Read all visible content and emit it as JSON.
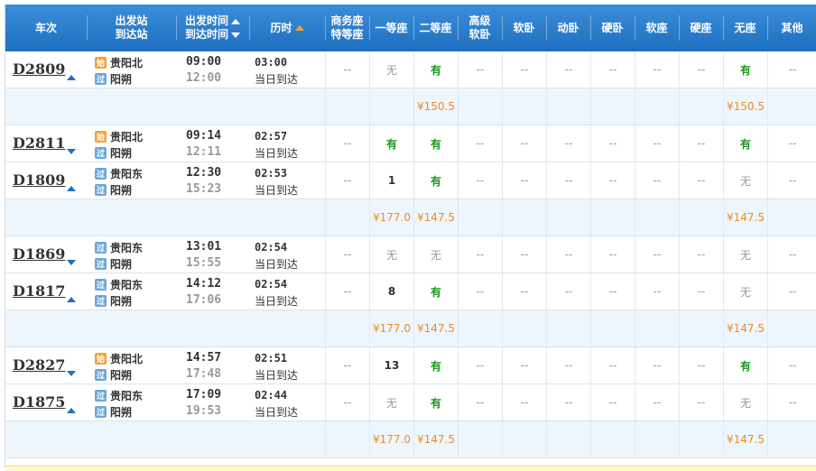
{
  "headers": {
    "train_no": "车次",
    "station_top": "出发站",
    "station_bottom": "到达站",
    "time_top": "出发时间",
    "time_bottom": "到达时间",
    "duration": "历时",
    "business_top": "商务座",
    "business_bottom": "特等座",
    "first": "一等座",
    "second": "二等座",
    "adv_soft_top": "高级",
    "adv_soft_bottom": "软卧",
    "soft_sleeper": "软卧",
    "moving_sleeper": "动卧",
    "hard_sleeper": "硬卧",
    "soft_seat": "软座",
    "hard_seat": "硬座",
    "no_seat": "无座",
    "other": "其他"
  },
  "badges": {
    "start": "始",
    "pass": "过"
  },
  "trains": [
    {
      "no": "D2809",
      "toggle": "up",
      "from": "贵阳北",
      "from_badge": "始",
      "to": "阳朔",
      "to_badge": "过",
      "dep": "09:00",
      "arr": "12:00",
      "dur": "03:00",
      "arrive_note": "当日到达",
      "seats": [
        "--",
        "无",
        "有",
        "--",
        "--",
        "--",
        "--",
        "--",
        "--",
        "有",
        "--"
      ],
      "prices": [
        "",
        "",
        "¥150.5",
        "",
        "",
        "",
        "",
        "",
        "",
        "¥150.5",
        ""
      ]
    },
    {
      "no": "D2811",
      "toggle": "down",
      "from": "贵阳北",
      "from_badge": "始",
      "to": "阳朔",
      "to_badge": "过",
      "dep": "09:14",
      "arr": "12:11",
      "dur": "02:57",
      "arrive_note": "当日到达",
      "seats": [
        "--",
        "有",
        "有",
        "--",
        "--",
        "--",
        "--",
        "--",
        "--",
        "有",
        "--"
      ],
      "prices": null
    },
    {
      "no": "D1809",
      "toggle": "up",
      "from": "贵阳东",
      "from_badge": "过",
      "to": "阳朔",
      "to_badge": "过",
      "dep": "12:30",
      "arr": "15:23",
      "dur": "02:53",
      "arrive_note": "当日到达",
      "seats": [
        "--",
        "1",
        "有",
        "--",
        "--",
        "--",
        "--",
        "--",
        "--",
        "无",
        "--"
      ],
      "prices": [
        "",
        "¥177.0",
        "¥147.5",
        "",
        "",
        "",
        "",
        "",
        "",
        "¥147.5",
        ""
      ]
    },
    {
      "no": "D1869",
      "toggle": "down",
      "from": "贵阳东",
      "from_badge": "过",
      "to": "阳朔",
      "to_badge": "过",
      "dep": "13:01",
      "arr": "15:55",
      "dur": "02:54",
      "arrive_note": "当日到达",
      "seats": [
        "--",
        "无",
        "无",
        "--",
        "--",
        "--",
        "--",
        "--",
        "--",
        "无",
        "--"
      ],
      "prices": null
    },
    {
      "no": "D1817",
      "toggle": "up",
      "from": "贵阳东",
      "from_badge": "过",
      "to": "阳朔",
      "to_badge": "过",
      "dep": "14:12",
      "arr": "17:06",
      "dur": "02:54",
      "arrive_note": "当日到达",
      "seats": [
        "--",
        "8",
        "有",
        "--",
        "--",
        "--",
        "--",
        "--",
        "--",
        "无",
        "--"
      ],
      "prices": [
        "",
        "¥177.0",
        "¥147.5",
        "",
        "",
        "",
        "",
        "",
        "",
        "¥147.5",
        ""
      ]
    },
    {
      "no": "D2827",
      "toggle": "down",
      "from": "贵阳北",
      "from_badge": "始",
      "to": "阳朔",
      "to_badge": "过",
      "dep": "14:57",
      "arr": "17:48",
      "dur": "02:51",
      "arrive_note": "当日到达",
      "seats": [
        "--",
        "13",
        "有",
        "--",
        "--",
        "--",
        "--",
        "--",
        "--",
        "有",
        "--"
      ],
      "prices": null
    },
    {
      "no": "D1875",
      "toggle": "up",
      "from": "贵阳东",
      "from_badge": "过",
      "to": "阳朔",
      "to_badge": "过",
      "dep": "17:09",
      "arr": "19:53",
      "dur": "02:44",
      "arrive_note": "当日到达",
      "seats": [
        "--",
        "无",
        "有",
        "--",
        "--",
        "--",
        "--",
        "--",
        "--",
        "无",
        "--"
      ],
      "prices": [
        "",
        "¥177.0",
        "¥147.5",
        "",
        "",
        "",
        "",
        "",
        "",
        "¥147.5",
        ""
      ]
    }
  ],
  "colors": {
    "header": "#1d6fc0",
    "available": "#1a9b1a",
    "price": "#f08a24",
    "unavailable": "#999999"
  }
}
